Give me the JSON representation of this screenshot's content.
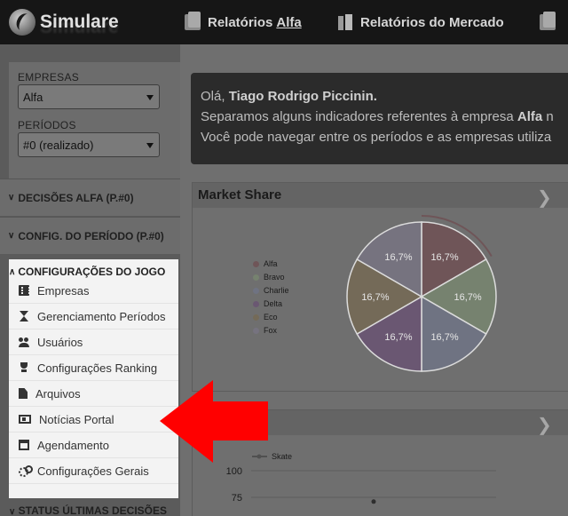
{
  "navbar": {
    "brand": "Simulare",
    "items": [
      {
        "prefix": "Relatórios",
        "highlight": "Alfa",
        "icon": "documents-icon"
      },
      {
        "label": "Relatórios do Mercado",
        "icon": "buildings-icon"
      }
    ]
  },
  "sidebar": {
    "empresas_label": "EMPRESAS",
    "empresas_value": "Alfa",
    "periodos_label": "PERÍODOS",
    "periodos_value": "#0 (realizado)",
    "sections": [
      {
        "label": "DECISÕES ALFA (P.#0)"
      },
      {
        "label": "CONFIG. DO PERÍODO (P.#0)"
      }
    ],
    "config_title": "CONFIGURAÇÕES DO JOGO",
    "config_items": [
      {
        "label": "Empresas",
        "icon": "building-icon"
      },
      {
        "label": "Gerenciamento Períodos",
        "icon": "hourglass-icon"
      },
      {
        "label": "Usuários",
        "icon": "users-icon"
      },
      {
        "label": "Configurações Ranking",
        "icon": "trophy-icon"
      },
      {
        "label": "Arquivos",
        "icon": "file-icon"
      },
      {
        "label": "Notícias Portal",
        "icon": "newspaper-icon"
      },
      {
        "label": "Agendamento",
        "icon": "calendar-icon"
      },
      {
        "label": "Configurações Gerais",
        "icon": "cogs-icon"
      }
    ],
    "status_label": "STATUS ÚLTIMAS DECISÕES"
  },
  "welcome": {
    "greeting": "Olá,",
    "name": "Tiago Rodrigo Piccinin.",
    "line2_prefix": "Separamos alguns indicadores referentes à empresa",
    "line2_company": "Alfa",
    "line2_suffix": "n",
    "line3": "Você pode navegar entre os períodos e as empresas utiliza"
  },
  "market_share": {
    "title": "Market Share",
    "chart_data": {
      "type": "pie",
      "title": "Market Share",
      "legend_position": "left",
      "slices": [
        {
          "label": "Alfa",
          "value": 16.7,
          "text": "16,7%",
          "color": "#6f5558"
        },
        {
          "label": "Bravo",
          "value": 16.7,
          "text": "16,7%",
          "color": "#76826f"
        },
        {
          "label": "Charlie",
          "value": 16.7,
          "text": "16,7%",
          "color": "#6f7382"
        },
        {
          "label": "Delta",
          "value": 16.7,
          "text": "16,7%",
          "color": "#6a5772"
        },
        {
          "label": "Eco",
          "value": 16.7,
          "text": "16,7%",
          "color": "#746a58"
        },
        {
          "label": "Fox",
          "value": 16.7,
          "text": "16,7%",
          "color": "#76737f"
        }
      ]
    }
  },
  "second_chart": {
    "title": "",
    "chart_data": {
      "type": "line",
      "series": [
        {
          "name": "Skate",
          "color": "#505050"
        }
      ],
      "y_ticks": [
        "100",
        "75"
      ],
      "visible_point_y": 79
    }
  },
  "annotation": {
    "arrow_color": "#ff0000"
  }
}
